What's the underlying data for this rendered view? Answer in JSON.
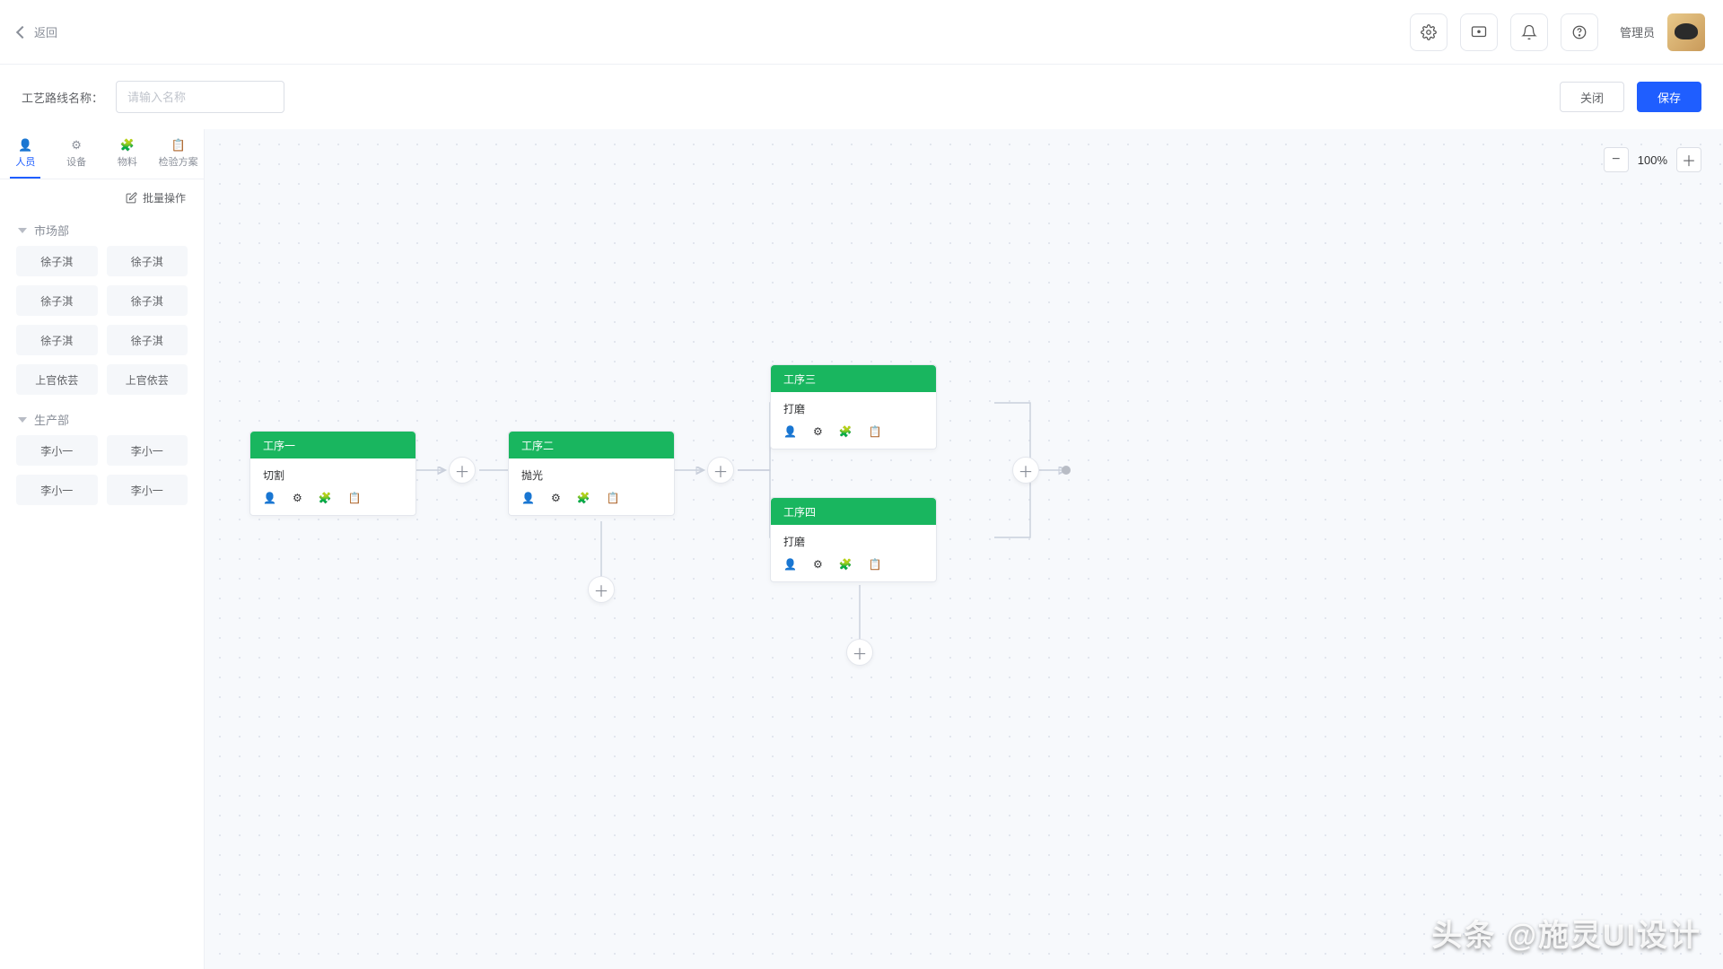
{
  "header": {
    "back": "返回",
    "user_role": "管理员"
  },
  "action_bar": {
    "name_label": "工艺路线名称：",
    "name_placeholder": "请输入名称",
    "close": "关闭",
    "save": "保存"
  },
  "sidebar": {
    "tabs": [
      {
        "label": "人员",
        "icon": "👤"
      },
      {
        "label": "设备",
        "icon": "⚙"
      },
      {
        "label": "物料",
        "icon": "🧩"
      },
      {
        "label": "检验方案",
        "icon": "📋"
      }
    ],
    "batch_label": "批量操作",
    "groups": [
      {
        "title": "市场部",
        "members": [
          "徐子淇",
          "徐子淇",
          "徐子淇",
          "徐子淇",
          "徐子淇",
          "徐子淇",
          "上官依芸",
          "上官依芸"
        ]
      },
      {
        "title": "生产部",
        "members": [
          "李小一",
          "李小一",
          "李小一",
          "李小一"
        ]
      }
    ]
  },
  "canvas": {
    "zoom": "100%",
    "icons": {
      "person": "👤",
      "gear": "⚙",
      "material": "🧩",
      "doc": "📋"
    },
    "nodes": [
      {
        "title": "工序一",
        "sub": "切割"
      },
      {
        "title": "工序二",
        "sub": "抛光"
      },
      {
        "title": "工序三",
        "sub": "打磨"
      },
      {
        "title": "工序四",
        "sub": "打磨"
      }
    ]
  },
  "watermark": "头条 @施灵UI设计"
}
